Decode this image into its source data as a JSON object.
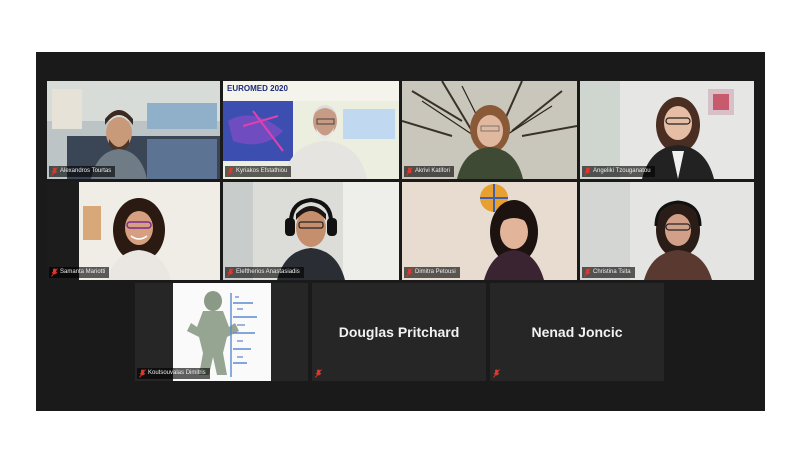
{
  "participants": [
    {
      "name": "Alexandros Tourtas",
      "muted": true
    },
    {
      "name": "Kyriakos Efstathiou",
      "muted": true,
      "speaking": true,
      "banner": "EUROMED 2020"
    },
    {
      "name": "Akrivi Katifori",
      "muted": true
    },
    {
      "name": "Angeliki Tzouganatou",
      "muted": true
    },
    {
      "name": "Samanta Mariotti",
      "muted": true
    },
    {
      "name": "Eleftherios Anastasiadis",
      "muted": true
    },
    {
      "name": "Dimitra Petousi",
      "muted": true
    },
    {
      "name": "Christina Tsita",
      "muted": true
    },
    {
      "name": "Koutsouvalas Dimitris",
      "muted": true
    },
    {
      "name": "Douglas Pritchard",
      "muted": true
    },
    {
      "name": "Nenad Joncic",
      "muted": true
    }
  ],
  "colors": {
    "mute_red": "#e0362c",
    "active_speaker": "#ffe600",
    "gallery_bg": "#1a1a1a"
  }
}
